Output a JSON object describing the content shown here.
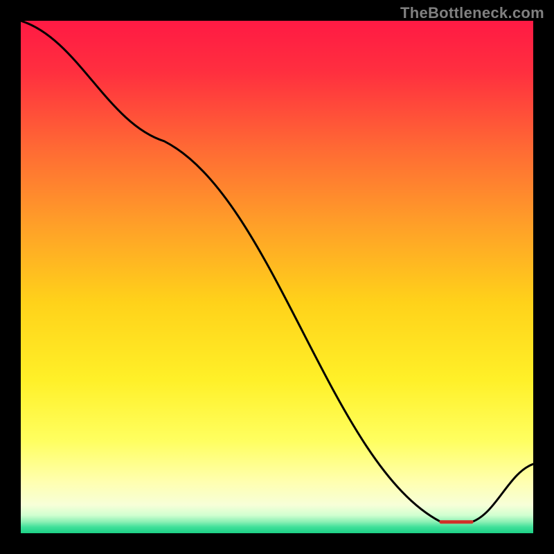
{
  "watermark": "TheBottleneck.com",
  "chart_data": {
    "type": "line",
    "title": "",
    "xlabel": "",
    "ylabel": "",
    "xlim": [
      0,
      100
    ],
    "ylim": [
      0,
      100
    ],
    "series": [
      {
        "name": "curve",
        "x": [
          0,
          28,
          82,
          88,
          100
        ],
        "y": [
          100,
          76.5,
          2.2,
          2.2,
          13.5
        ]
      }
    ],
    "gradient_stops": [
      {
        "offset": 0.0,
        "color": "#ff1a44"
      },
      {
        "offset": 0.1,
        "color": "#ff2f3f"
      },
      {
        "offset": 0.25,
        "color": "#ff6a34"
      },
      {
        "offset": 0.4,
        "color": "#ffa028"
      },
      {
        "offset": 0.55,
        "color": "#ffd21a"
      },
      {
        "offset": 0.7,
        "color": "#fff028"
      },
      {
        "offset": 0.82,
        "color": "#ffff60"
      },
      {
        "offset": 0.9,
        "color": "#ffffb0"
      },
      {
        "offset": 0.945,
        "color": "#f7ffd8"
      },
      {
        "offset": 0.965,
        "color": "#d0ffd0"
      },
      {
        "offset": 0.978,
        "color": "#8af0b4"
      },
      {
        "offset": 0.988,
        "color": "#3fe09a"
      },
      {
        "offset": 1.0,
        "color": "#1cd185"
      }
    ],
    "flat_band": {
      "present": true,
      "y_value": 2.2,
      "x_start": 82,
      "x_end": 88,
      "color": "#d03028",
      "thickness": 5
    }
  }
}
